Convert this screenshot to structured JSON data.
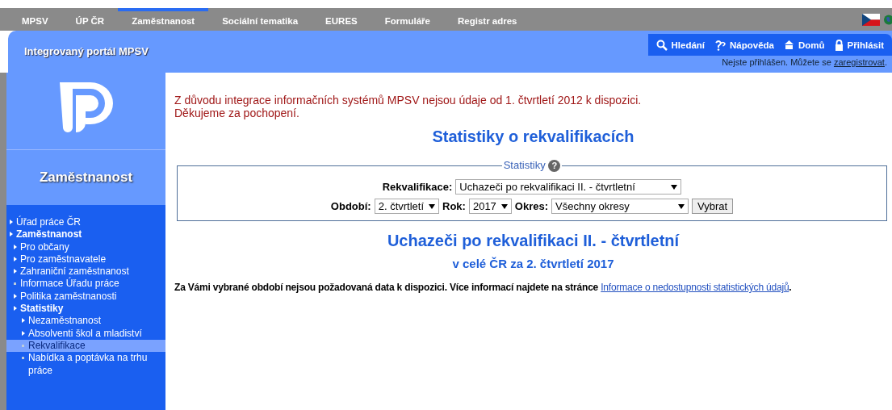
{
  "top_nav": [
    {
      "label": "MPSV",
      "selected": false
    },
    {
      "label": "ÚP ČR",
      "selected": false
    },
    {
      "label": "Zaměstnanost",
      "selected": true
    },
    {
      "label": "Sociální tematika",
      "selected": false
    },
    {
      "label": "EURES",
      "selected": false
    },
    {
      "label": "Formuláře",
      "selected": false
    },
    {
      "label": "Registr adres",
      "selected": false
    }
  ],
  "header": {
    "title": "Integrovaný portál MPSV",
    "tools": [
      {
        "kind": "search",
        "label": "Hledání"
      },
      {
        "kind": "help",
        "label": "Nápověda"
      },
      {
        "kind": "home",
        "label": "Domů"
      },
      {
        "kind": "lock",
        "label": "Přihlásit"
      }
    ],
    "login_note": "Nejste přihlášen. Můžete se ",
    "register_link": "zaregistrovat",
    "login_end": "."
  },
  "sidebar": {
    "title": "Zaměstnanost",
    "items": [
      {
        "label": "Úřad práce ČR",
        "kind": "arrow",
        "expanded": false,
        "selected": false
      },
      {
        "label": "Zaměstnanost",
        "kind": "arrow",
        "expanded": true,
        "selected": false,
        "children": [
          {
            "label": "Pro občany",
            "kind": "arrow",
            "expanded": false,
            "selected": false
          },
          {
            "label": "Pro zaměstnavatele",
            "kind": "arrow",
            "expanded": false,
            "selected": false
          },
          {
            "label": "Zahraniční zaměstnanost",
            "kind": "arrow",
            "expanded": false,
            "selected": false
          },
          {
            "label": "Informace Úřadu práce",
            "kind": "dot",
            "expanded": false,
            "selected": false
          },
          {
            "label": "Politika zaměstnanosti",
            "kind": "arrow",
            "expanded": false,
            "selected": false
          },
          {
            "label": "Statistiky",
            "kind": "arrow",
            "expanded": true,
            "selected": false,
            "children": [
              {
                "label": "Nezaměstnanost",
                "kind": "arrow",
                "expanded": false,
                "selected": false
              },
              {
                "label": "Absolventi škol a mladiství",
                "kind": "arrow",
                "expanded": false,
                "selected": false
              },
              {
                "label": "Rekvalifikace",
                "kind": "dot",
                "expanded": false,
                "selected": true
              },
              {
                "label": "Nabídka a poptávka na trhu práce",
                "kind": "dot",
                "expanded": false,
                "selected": false
              }
            ]
          }
        ]
      }
    ]
  },
  "notice": [
    "Z důvodu integrace informačních systémů MPSV nejsou údaje od 1. čtvrtletí 2012 k dispozici.",
    "Děkujeme za pochopení."
  ],
  "page_title": "Statistiky o rekvalifikacích",
  "form": {
    "legend": "Statistiky",
    "help_icon": "?",
    "rekvalifikace": {
      "label": "Rekvalifikace:",
      "value": "Uchazeči po rekvalifikaci II. - čtvrtletní"
    },
    "obdobi": {
      "label": "Období:",
      "value": "2. čtvrtletí"
    },
    "rok": {
      "label": "Rok:",
      "value": "2017"
    },
    "okres": {
      "label": "Okres:",
      "value": "Všechny okresy"
    },
    "submit": "Vybrat"
  },
  "result_title": "Uchazeči po rekvalifikaci II. - čtvrtletní",
  "result_subtitle": "v celé ČR za 2. čtvrtletí 2017",
  "message": "Za Vámi vybrané období nejsou požadovaná data k dispozici. Více informací najdete na stránce ",
  "message_link": "Informace o nedostupnosti statistických údajů",
  "message_end": "."
}
